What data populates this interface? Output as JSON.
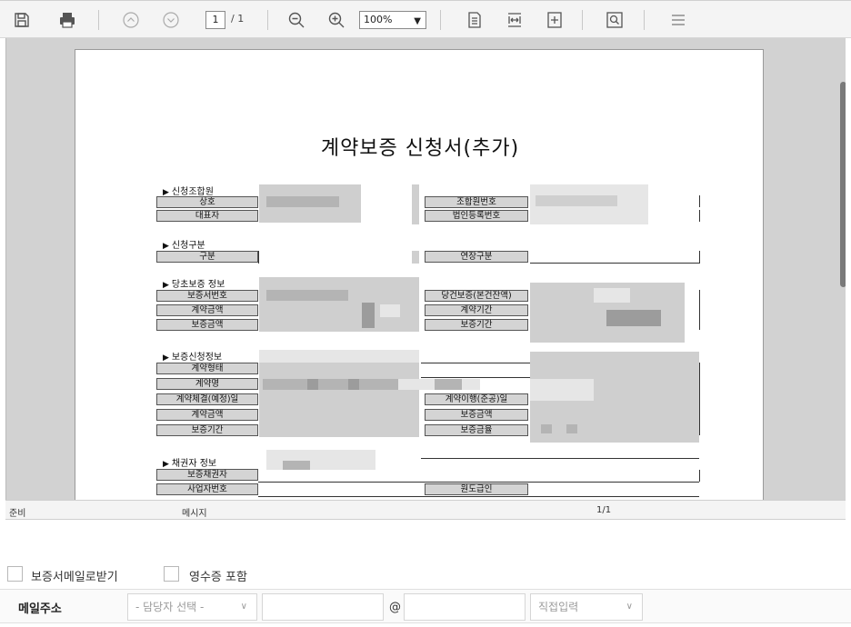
{
  "toolbar": {
    "page_current": "1",
    "page_total": "/ 1",
    "zoom": "100%",
    "icons": [
      "save-icon",
      "print-icon",
      "prev-page-icon",
      "next-page-icon",
      "zoom-out-icon",
      "zoom-in-icon",
      "fit-page-icon",
      "fit-width-icon",
      "actual-size-icon",
      "search-icon",
      "menu-icon"
    ]
  },
  "document": {
    "title": "계약보증 신청서(추가)",
    "sections": {
      "applicant": "신청조합원",
      "type": "신청구분",
      "original": "당초보증 정보",
      "request": "보증신청정보",
      "creditor": "채권자 정보"
    },
    "labels": {
      "company": "상호",
      "ceo": "대표자",
      "member_no": "조합원번호",
      "corp_no": "법인등록번호",
      "category": "구분",
      "extension": "연장구분",
      "guarantee_no": "보증서번호",
      "contract_amount": "계약금액",
      "guarantee_amount": "보증금액",
      "original_balance": "당건보증(본건잔액)",
      "contract_period": "계약기간",
      "guarantee_period": "보증기간",
      "contract_form": "계약형태",
      "contract_name": "계약명",
      "contract_date": "계약체결(예정)일",
      "contract_amount2": "계약금액",
      "guarantee_period2": "보증기간",
      "fulfillment_date": "계약이행(준공)일",
      "guarantee_amount2": "보증금액",
      "guarantee_rate": "보증금율",
      "creditor": "보증채권자",
      "business_no": "사업자번호",
      "subcontract": "원도급인"
    }
  },
  "statusbar": {
    "state": "준비",
    "message": "메시지",
    "pages": "1/1"
  },
  "form": {
    "chk_mail": "보증서메일로받기",
    "chk_receipt": "영수증 포함",
    "mail_label": "메일주소",
    "select_person": "- 담당자 선택 -",
    "at": "@",
    "select_domain": "직접입력"
  }
}
